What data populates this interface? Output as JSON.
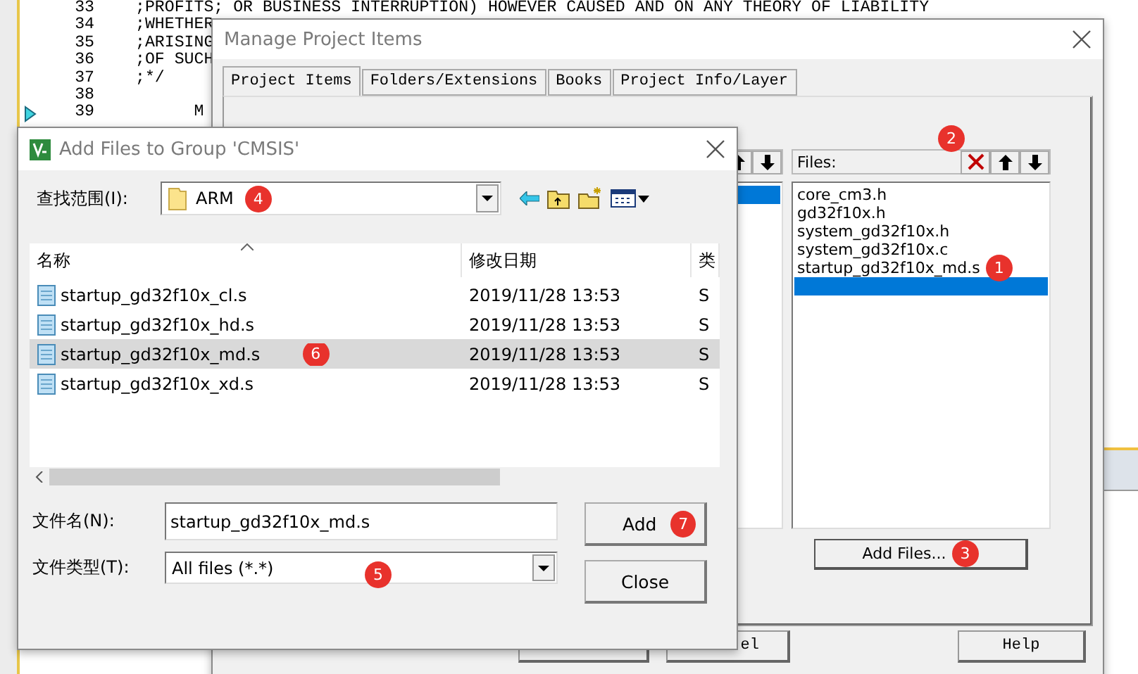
{
  "editor": {
    "lines": [
      {
        "number": "33",
        "text": ";PROFITS; OR BUSINESS INTERRUPTION) HOWEVER CAUSED AND ON ANY THEORY OF LIABILITY",
        "current": false
      },
      {
        "number": "34",
        "text": ";WHETHER",
        "current": false
      },
      {
        "number": "35",
        "text": ";ARISING",
        "current": false
      },
      {
        "number": "36",
        "text": ";OF SUCH",
        "current": false
      },
      {
        "number": "37",
        "text": ";*/",
        "current": false
      },
      {
        "number": "38",
        "current": false
      },
      {
        "number": "39",
        "text": "      M",
        "current": true
      }
    ]
  },
  "manage_dialog": {
    "title": "Manage Project Items",
    "tabs": [
      {
        "label": "Project Items",
        "selected": true
      },
      {
        "label": "Folders/Extensions",
        "selected": false
      },
      {
        "label": "Books",
        "selected": false
      },
      {
        "label": "Project Info/Layer",
        "selected": false
      }
    ],
    "groups": {
      "rows": [
        {
          "selected": true
        }
      ]
    },
    "files": {
      "label": "Files:",
      "toolbar_badge": "2",
      "items": [
        {
          "kind": "file",
          "name": "core_cm3.h",
          "selected": false
        },
        {
          "kind": "file",
          "name": "gd32f10x.h",
          "selected": false
        },
        {
          "kind": "file",
          "name": "system_gd32f10x.h",
          "selected": false
        },
        {
          "kind": "file",
          "name": "system_gd32f10x.c",
          "selected": false
        },
        {
          "kind": "file",
          "name": "startup_gd32f10x_md.s",
          "selected": false,
          "badge": "1"
        },
        {
          "kind": "blank",
          "selected": true
        }
      ]
    },
    "add_files": {
      "label": "Add Files...",
      "badge": "3"
    },
    "buttons": [
      {
        "kind": "plain"
      },
      {
        "kind": "label",
        "label": "el"
      },
      {
        "kind": "label",
        "label": "Help"
      }
    ]
  },
  "add_dialog": {
    "title": "Add Files to Group 'CMSIS'",
    "look_in": {
      "label": "查找范围(I):",
      "value": "ARM",
      "badge": "4"
    },
    "columns": [
      "名称",
      "修改日期",
      "类"
    ],
    "rows": [
      {
        "name": "startup_gd32f10x_cl.s",
        "date": "2019/11/28 13:53",
        "type": "S",
        "selected": false
      },
      {
        "name": "startup_gd32f10x_hd.s",
        "date": "2019/11/28 13:53",
        "type": "S",
        "selected": false
      },
      {
        "name": "startup_gd32f10x_md.s",
        "date": "2019/11/28 13:53",
        "type": "S",
        "selected": true,
        "badge": "6"
      },
      {
        "name": "startup_gd32f10x_xd.s",
        "date": "2019/11/28 13:53",
        "type": "S",
        "selected": false
      }
    ],
    "file_name": {
      "label": "文件名(N):",
      "value": "startup_gd32f10x_md.s"
    },
    "file_type": {
      "label": "文件类型(T):",
      "value": "All files (*.*)",
      "badge": "5"
    },
    "add_button": {
      "label": "Add",
      "badge": "7"
    },
    "close_button": {
      "label": "Close"
    }
  }
}
